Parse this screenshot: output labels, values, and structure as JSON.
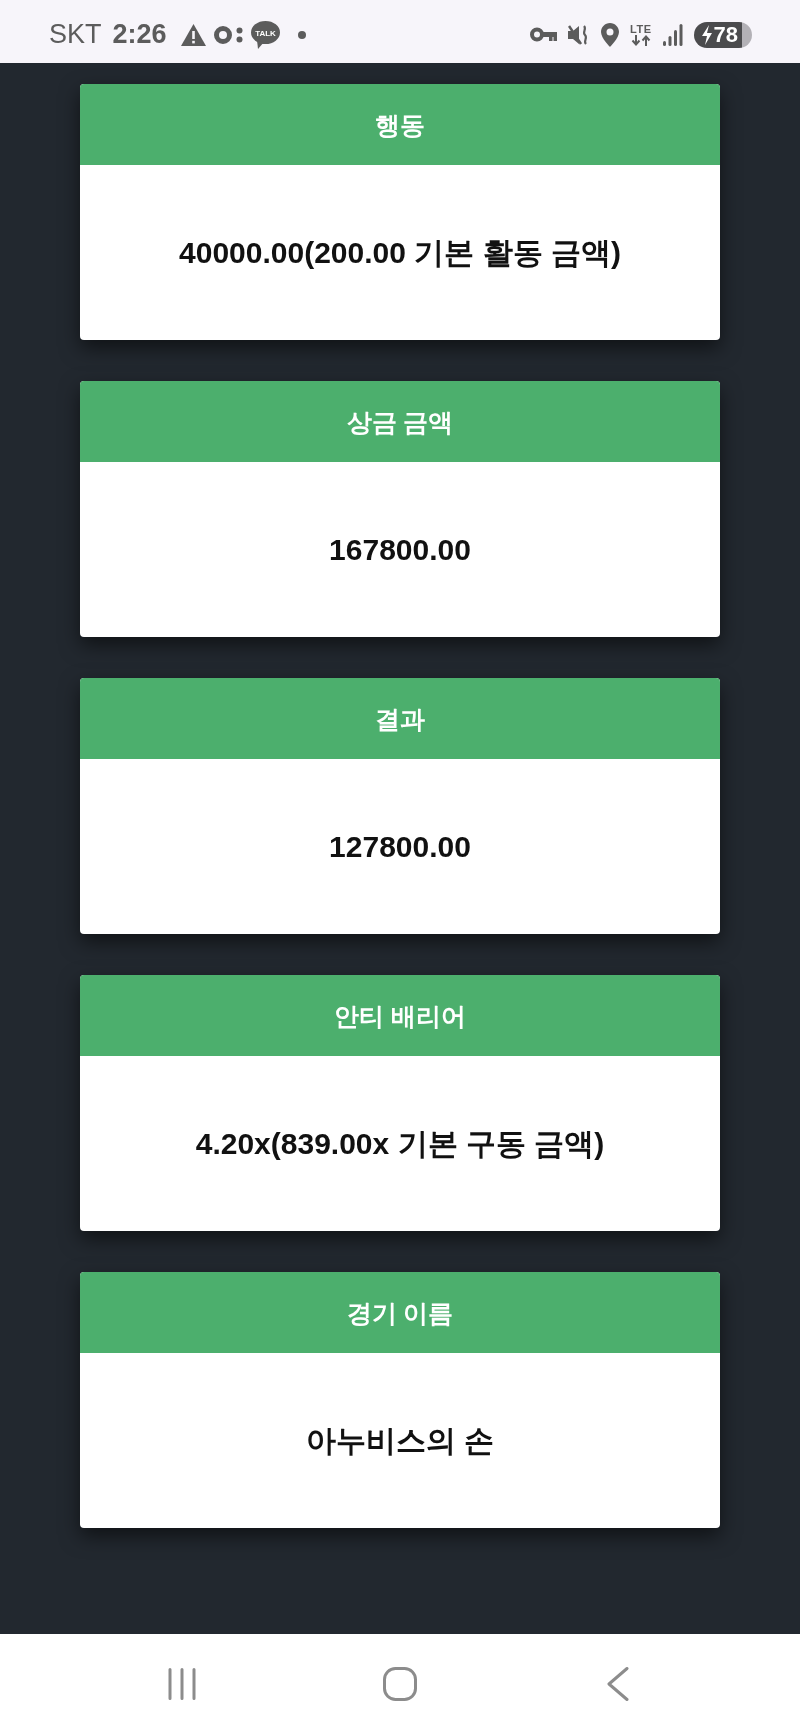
{
  "status_bar": {
    "carrier": "SKT",
    "time": "2:26",
    "chat_badge": "TALK",
    "network": "LTE",
    "battery": "78",
    "charging": true
  },
  "cards": [
    {
      "title": "행동",
      "value": "40000.00(200.00 기본 활동 금액)"
    },
    {
      "title": "상금 금액",
      "value": "167800.00"
    },
    {
      "title": "결과",
      "value": "127800.00"
    },
    {
      "title": "안티 배리어",
      "value": "4.20x(839.00x 기본 구동 금액)"
    },
    {
      "title": "경기 이름",
      "value": "아누비스의 손"
    }
  ]
}
